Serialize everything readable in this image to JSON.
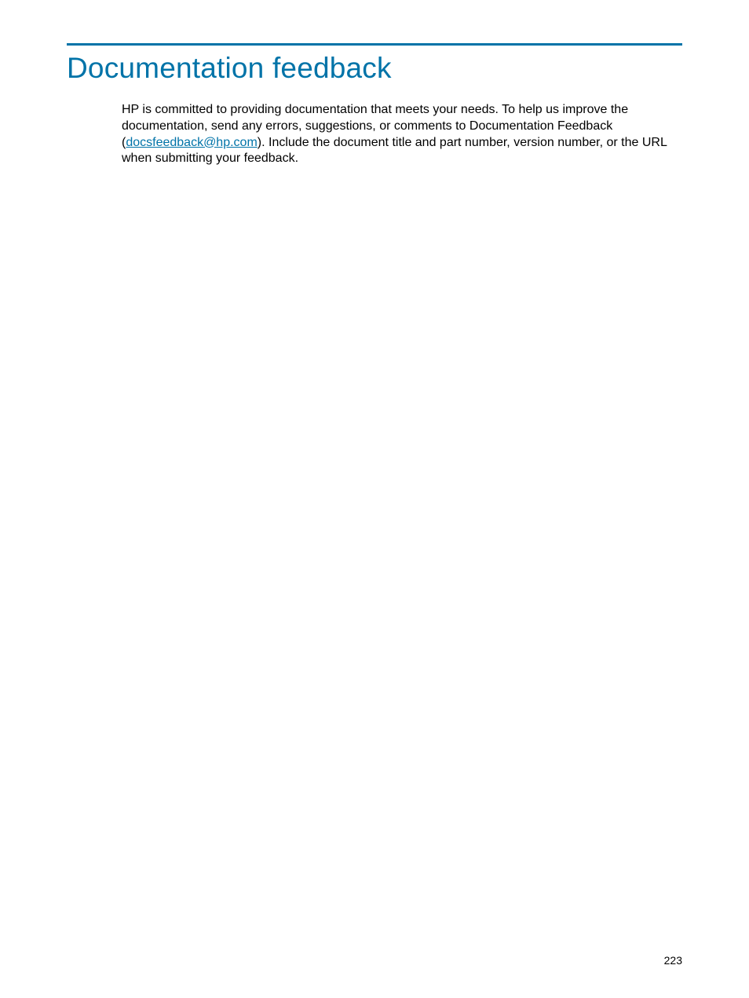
{
  "page": {
    "title": "Documentation feedback",
    "page_number": "223"
  },
  "body": {
    "text_before_link": "HP is committed to providing documentation that meets your needs. To help us improve the documentation, send any errors, suggestions, or comments to Documentation Feedback (",
    "email_link": "docsfeedback@hp.com",
    "text_after_link": "). Include the document title and part number, version number, or the URL when submitting your feedback."
  }
}
